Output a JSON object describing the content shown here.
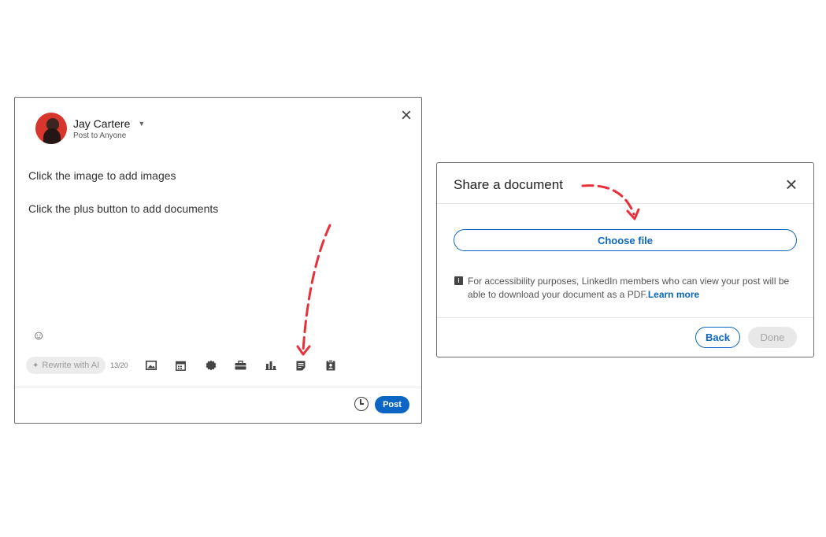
{
  "composer": {
    "author_name": "Jay Cartere",
    "visibility": "Post to Anyone",
    "body_lines": [
      "Click the image to add images",
      "Click the plus button to add documents"
    ],
    "rewrite_label": "Rewrite with AI",
    "char_count": "13/20",
    "post_label": "Post",
    "toolbar_icons": [
      "image-icon",
      "calendar-icon",
      "celebrate-icon",
      "briefcase-icon",
      "poll-icon",
      "document-icon",
      "clipboard-icon"
    ]
  },
  "share_dialog": {
    "title": "Share a document",
    "choose_file_label": "Choose file",
    "info_text": "For accessibility purposes, LinkedIn members who can view your post will be able to download your document as a PDF.",
    "learn_more": "Learn more",
    "back_label": "Back",
    "done_label": "Done"
  },
  "colors": {
    "accent": "#0a66c2",
    "annotation_arrow": "#e8303a"
  }
}
